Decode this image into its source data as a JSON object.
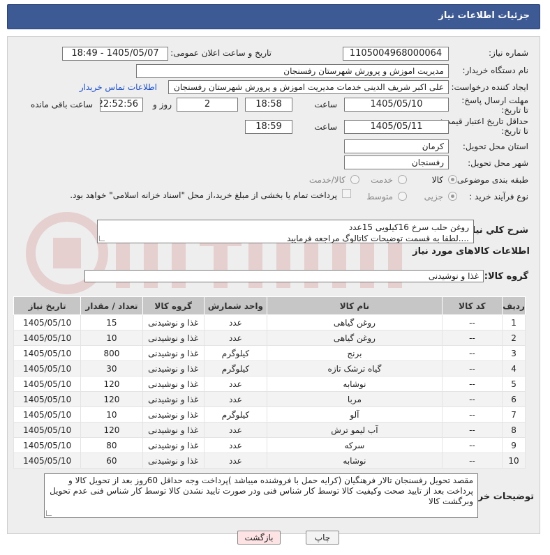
{
  "page": {
    "title": "جزئیات اطلاعات نیاز"
  },
  "form": {
    "need_number_label": "شماره نیاز:",
    "need_number": "1105004968000064",
    "announce_label": "تاریخ و ساعت اعلان عمومی:",
    "announce_value": "1405/05/07 - 18:49",
    "buyer_org_label": "نام دستگاه خریدار:",
    "buyer_org": "مدیریت اموزش و پرورش شهرستان رفسنجان",
    "requester_label": "ایجاد کننده درخواست:",
    "requester": "علی اکبر شریف الدینی خدمات مدیریت اموزش و پرورش شهرستان رفسنجان",
    "contact_link": "اطلاعات تماس خریدار",
    "deadline_label": "مهلت ارسال پاسخ: تا تاریخ:",
    "deadline_date": "1405/05/10",
    "time_label": "ساعت",
    "deadline_time": "18:58",
    "days_value": "2",
    "days_label": "روز و",
    "remaining_time": "22:52:56",
    "remaining_label": "ساعت باقی مانده",
    "validity_label": "حداقل تاریخ اعتبار قیمت: تا تاریخ:",
    "validity_date": "1405/05/11",
    "validity_time": "18:59",
    "province_label": "استان محل تحویل:",
    "province": "کرمان",
    "city_label": "شهر محل تحویل:",
    "city": "رفسنجان",
    "category_label": "طبقه بندی موضوعی:",
    "category_options": [
      "کالا",
      "خدمت",
      "کالا/خدمت"
    ],
    "process_label": "نوع فرآیند خرید :",
    "process_options": [
      "جزیی",
      "متوسط"
    ],
    "payment_note": "پرداخت تمام یا بخشی از مبلغ خرید،از محل \"اسناد خزانه اسلامی\" خواهد بود."
  },
  "description": {
    "label": "شرح كلي نياز:",
    "line1": "روغن حلب سرخ 16کیلویی 15عدد",
    "line2": "....لطفا به قسمت توضیحات کاتالوگ مراجعه فرمایید"
  },
  "goods": {
    "section_title": "اطلاعات کالاهای مورد نیاز",
    "group_label": "گروه کالا:",
    "group_value": "غذا و نوشیدنی",
    "headers": [
      "ردیف",
      "کد کالا",
      "نام کالا",
      "واحد شمارش",
      "گروه کالا",
      "تعداد / مقدار",
      "تاریخ نیاز"
    ],
    "rows": [
      {
        "idx": "1",
        "code": "--",
        "name": "روغن گیاهی",
        "unit": "عدد",
        "group": "غذا و نوشیدنی",
        "qty": "15",
        "date": "1405/05/10"
      },
      {
        "idx": "2",
        "code": "--",
        "name": "روغن گیاهی",
        "unit": "عدد",
        "group": "غذا و نوشیدنی",
        "qty": "10",
        "date": "1405/05/10"
      },
      {
        "idx": "3",
        "code": "--",
        "name": "برنج",
        "unit": "کیلوگرم",
        "group": "غذا و نوشیدنی",
        "qty": "800",
        "date": "1405/05/10"
      },
      {
        "idx": "4",
        "code": "--",
        "name": "گیاه ترشک تازه",
        "unit": "کیلوگرم",
        "group": "غذا و نوشیدنی",
        "qty": "30",
        "date": "1405/05/10"
      },
      {
        "idx": "5",
        "code": "--",
        "name": "نوشابه",
        "unit": "عدد",
        "group": "غذا و نوشیدنی",
        "qty": "120",
        "date": "1405/05/10"
      },
      {
        "idx": "6",
        "code": "--",
        "name": "مربا",
        "unit": "عدد",
        "group": "غذا و نوشیدنی",
        "qty": "120",
        "date": "1405/05/10"
      },
      {
        "idx": "7",
        "code": "--",
        "name": "آلو",
        "unit": "کیلوگرم",
        "group": "غذا و نوشیدنی",
        "qty": "10",
        "date": "1405/05/10"
      },
      {
        "idx": "8",
        "code": "--",
        "name": "آب لیمو ترش",
        "unit": "عدد",
        "group": "غذا و نوشیدنی",
        "qty": "120",
        "date": "1405/05/10"
      },
      {
        "idx": "9",
        "code": "--",
        "name": "سرکه",
        "unit": "عدد",
        "group": "غذا و نوشیدنی",
        "qty": "80",
        "date": "1405/05/10"
      },
      {
        "idx": "10",
        "code": "--",
        "name": "نوشابه",
        "unit": "عدد",
        "group": "غذا و نوشیدنی",
        "qty": "60",
        "date": "1405/05/10"
      }
    ]
  },
  "buyer_notes": {
    "label": "توضیحات خریدار:",
    "text": "مقصد تحویل رفسنجان تالار فرهنگیان (کرایه حمل با فروشنده میباشد )پرداخت وجه حداقل 60روز بعد از تحویل کالا و پرداخت بعد از تایید صحت وکیفیت کالا توسط کار شناس فنی ودر صورت تایید نشدن کالا توسط کار شناس فنی عدم تحویل وبرگشت کالا"
  },
  "buttons": {
    "print": "چاپ",
    "back": "بازگشت"
  },
  "colors": {
    "title_bar": "#3d5a94",
    "panel": "#eeeeee",
    "link": "#1a4fd1",
    "back_button": "#fde3e3",
    "print_button": "#f3f3f3"
  }
}
